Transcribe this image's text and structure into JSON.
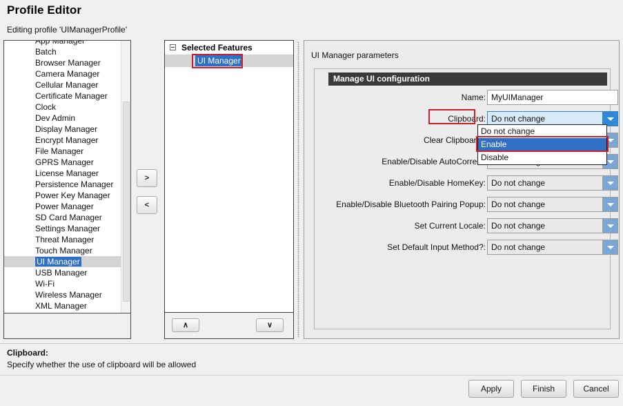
{
  "header": {
    "title": "Profile Editor",
    "subtitle": "Editing profile 'UIManagerProfile'"
  },
  "features_list": {
    "items": [
      "App Manager",
      "Batch",
      "Browser Manager",
      "Camera Manager",
      "Cellular Manager",
      "Certificate Manager",
      "Clock",
      "Dev Admin",
      "Display Manager",
      "Encrypt Manager",
      "File Manager",
      "GPRS Manager",
      "License Manager",
      "Persistence Manager",
      "Power Key Manager",
      "Power Manager",
      "SD Card Manager",
      "Settings Manager",
      "Threat Manager",
      "Touch Manager",
      "UI Manager",
      "USB Manager",
      "Wi-Fi",
      "Wireless Manager",
      "XML Manager"
    ],
    "selected": "UI Manager"
  },
  "transfer": {
    "add_label": ">",
    "remove_label": "<"
  },
  "selected_features": {
    "root_label": "Selected Features",
    "children": [
      "UI Manager"
    ],
    "move_up_label": "∧",
    "move_down_label": "∨"
  },
  "parameters": {
    "panel_title": "UI Manager parameters",
    "group_title": "Manage UI configuration",
    "fields": [
      {
        "label": "Name:",
        "type": "text",
        "value": "MyUIManager"
      },
      {
        "label": "Clipboard:",
        "type": "combo",
        "value": "Do not change",
        "focused": true
      },
      {
        "label": "Clear Clipboard?",
        "type": "combo",
        "value": "Do not change"
      },
      {
        "label": "Enable/Disable AutoCorrect:",
        "type": "combo",
        "value": "Do not change"
      },
      {
        "label": "Enable/Disable HomeKey:",
        "type": "combo",
        "value": "Do not change"
      },
      {
        "label": "Enable/Disable Bluetooth Pairing Popup:",
        "type": "combo",
        "value": "Do not change"
      },
      {
        "label": "Set Current Locale:",
        "type": "combo",
        "value": "Do not change"
      },
      {
        "label": "Set Default Input Method?:",
        "type": "combo",
        "value": "Do not change"
      }
    ]
  },
  "dropdown": {
    "options": [
      "Do not change",
      "Enable",
      "Disable"
    ],
    "highlighted": "Enable"
  },
  "description": {
    "title": "Clipboard:",
    "body": "Specify whether the use of clipboard will be allowed"
  },
  "footer": {
    "apply_label": "Apply",
    "finish_label": "Finish",
    "cancel_label": "Cancel"
  },
  "colors": {
    "selection_blue": "#2f6fc4",
    "highlight_red": "#cc1f2a",
    "group_header_bg": "#3a3a3a"
  }
}
